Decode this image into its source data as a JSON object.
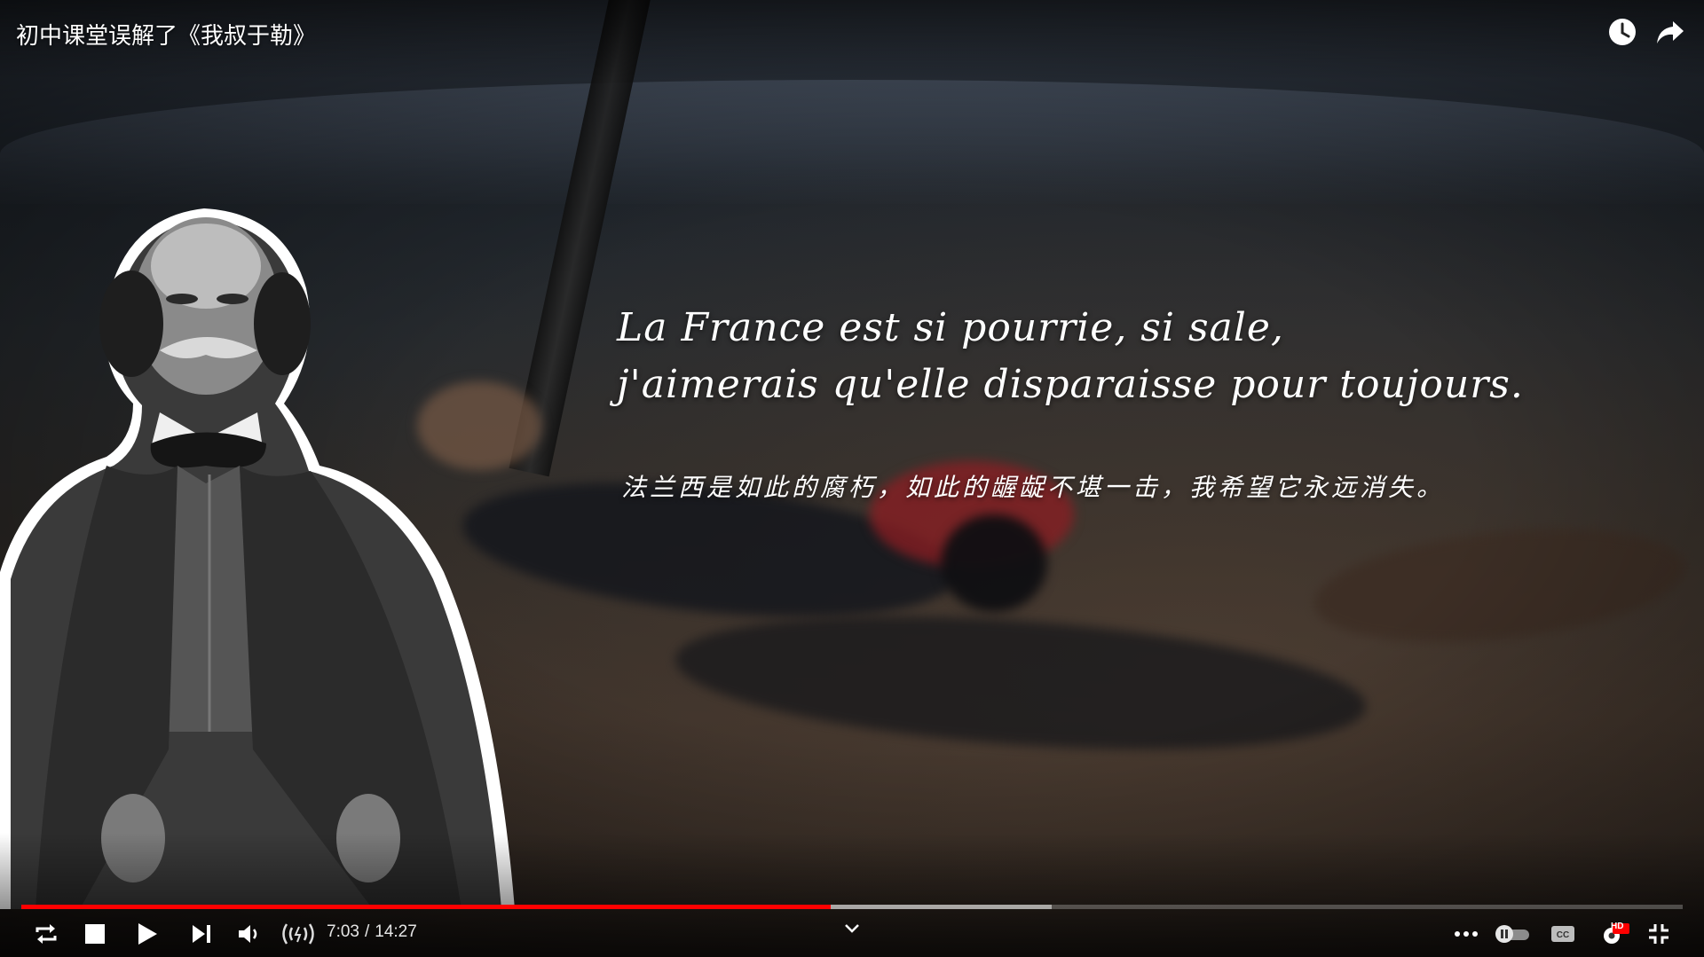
{
  "video": {
    "title": "初中课堂误解了《我叔于勒》",
    "quote_fr_line1": "La France est si pourrie, si sale,",
    "quote_fr_line2": "j'aimerais qu'elle disparaisse pour toujours.",
    "quote_zh": "法兰西是如此的腐朽，如此的龌龊不堪一击，我希望它永远消失。"
  },
  "top_controls": {
    "icons": [
      "watch-later-icon",
      "share-icon"
    ]
  },
  "playback": {
    "current_time": "7:03",
    "separator": "/",
    "duration": "14:27",
    "played_fraction": 0.487,
    "buffered_fraction": 0.62,
    "progress_color": "#ff0000"
  },
  "controls": {
    "left_icons": [
      "loop-icon",
      "stop-icon",
      "play-icon",
      "next-icon",
      "volume-icon",
      "live-audio-icon"
    ],
    "center_icon": "chevron-down-icon",
    "right_icons": [
      "more-icon",
      "autoplay-toggle-icon",
      "captions-icon",
      "settings-hd-icon",
      "exit-fullscreen-icon"
    ],
    "hd_badge": "HD"
  }
}
